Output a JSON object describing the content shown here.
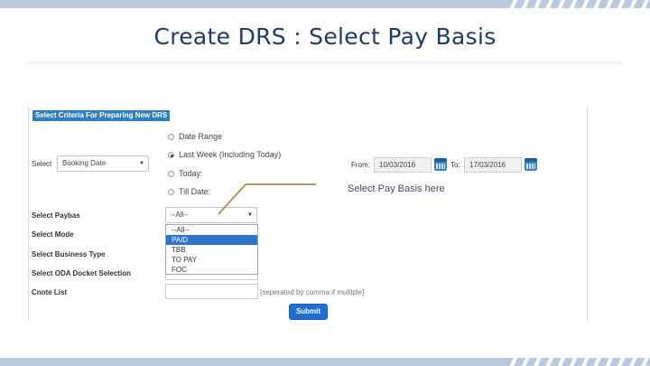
{
  "slide": {
    "title": "Create DRS : Select Pay Basis",
    "callout_text": "Select Pay Basis here",
    "accent_color": "#b9c9de",
    "title_color": "#1f3a63",
    "callout_line_color": "#b08a50"
  },
  "form": {
    "header": "Select Criteria For Preparing New DRS",
    "select_label": "Select",
    "select_value": "Booking Date",
    "radio_options": [
      {
        "label": "Date Range",
        "checked": false
      },
      {
        "label": "Last Week (Including Today)",
        "checked": true
      },
      {
        "label": "Today:",
        "checked": false
      },
      {
        "label": "Till Date:",
        "checked": false
      }
    ],
    "from_label": "From:",
    "from_value": "10/03/2016",
    "to_label": "To:",
    "to_value": "17/03/2016",
    "paybas_label": "Select Paybas",
    "paybas_value": "--All--",
    "paybas_options": [
      "--All--",
      "PAID",
      "TBB",
      "TO PAY",
      "FOC"
    ],
    "paybas_selected": "PAID",
    "mode_label": "Select Mode",
    "business_type_label": "Select Business Type",
    "oda_label": "Select ODA Docket Selection",
    "cnote_label": "Cnote List",
    "cnote_hint": "[seperated by comma if multiple]",
    "submit_label": "Submit",
    "primary_color": "#1e6fd0",
    "header_color": "#2f7fbf"
  }
}
